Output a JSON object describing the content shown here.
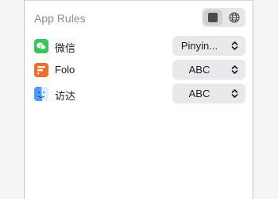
{
  "section": {
    "title": "App Rules"
  },
  "toggle": {
    "options": [
      {
        "icon": "square-icon",
        "active": true
      },
      {
        "icon": "globe-icon",
        "active": false
      }
    ]
  },
  "rules": [
    {
      "app": "微信",
      "icon": "wechat-icon",
      "icon_color": "#34c759",
      "value": "Pinyin..."
    },
    {
      "app": "Folo",
      "icon": "folo-icon",
      "icon_color": "#f26d2b",
      "value": "ABC"
    },
    {
      "app": "访达",
      "icon": "finder-icon",
      "icon_color": "#4a9df8",
      "value": "ABC"
    }
  ]
}
